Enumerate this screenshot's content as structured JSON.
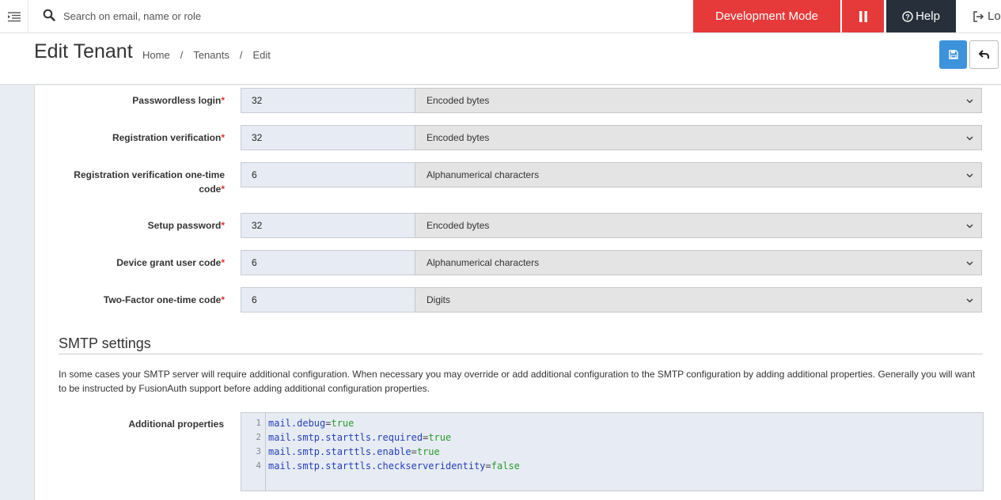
{
  "topbar": {
    "search_placeholder": "Search on email, name or role",
    "dev_mode_label": "Development Mode",
    "help_label": "Help",
    "logout_label": "Lo",
    "colors": {
      "dev_mode": "#e63a3a",
      "help": "#27303a"
    }
  },
  "header": {
    "title": "Edit Tenant",
    "breadcrumb": [
      "Home",
      "Tenants",
      "Edit"
    ],
    "save_icon": "floppy-disk-icon",
    "back_icon": "undo-arrow-icon",
    "colors": {
      "save": "#3d93db"
    }
  },
  "rows": [
    {
      "label": "Passwordless login",
      "required": "*",
      "value": "32",
      "type": "Encoded bytes"
    },
    {
      "label": "Registration verification",
      "required": "*",
      "value": "32",
      "type": "Encoded bytes"
    },
    {
      "label": "Registration verification one-time code",
      "required": "*",
      "value": "6",
      "type": "Alphanumerical characters"
    },
    {
      "label": "Setup password",
      "required": "*",
      "value": "32",
      "type": "Encoded bytes"
    },
    {
      "label": "Device grant user code",
      "required": "*",
      "value": "6",
      "type": "Alphanumerical characters"
    },
    {
      "label": "Two-Factor one-time code",
      "required": "*",
      "value": "6",
      "type": "Digits"
    }
  ],
  "smtp": {
    "title": "SMTP settings",
    "description": "In some cases your SMTP server will require additional configuration. When necessary you may override or add additional configuration to the SMTP configuration by adding additional properties. Generally you will want to be instructed by FusionAuth support before adding additional configuration properties.",
    "properties_label": "Additional properties",
    "lines": [
      {
        "n": "1",
        "key": "mail.debug",
        "eq": "=",
        "val": "true"
      },
      {
        "n": "2",
        "key": "mail.smtp.starttls.required",
        "eq": "=",
        "val": "true"
      },
      {
        "n": "3",
        "key": "mail.smtp.starttls.enable",
        "eq": "=",
        "val": "true"
      },
      {
        "n": "4",
        "key": "mail.smtp.starttls.checkserveridentity",
        "eq": "=",
        "val": "false"
      }
    ]
  }
}
